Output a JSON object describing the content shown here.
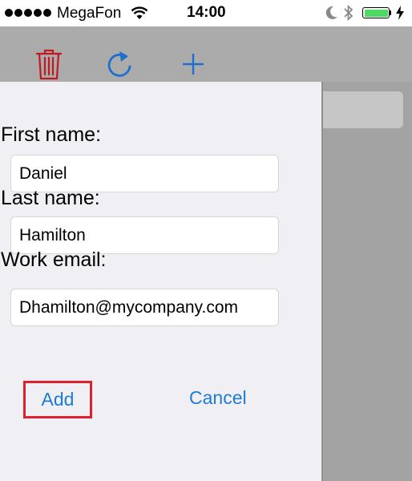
{
  "status_bar": {
    "carrier": "MegaFon",
    "time": "14:00"
  },
  "toolbar": {
    "icons": [
      "trash-icon",
      "refresh-icon",
      "plus-icon"
    ],
    "trash_color": "#c0191f",
    "accent_color": "#1e6fd0"
  },
  "form": {
    "first_name_label": "First name:",
    "first_name_value": "Daniel",
    "last_name_label": "Last name:",
    "last_name_value": "Hamilton",
    "email_label": "Work email:",
    "email_value": "Dhamilton@mycompany.com"
  },
  "actions": {
    "add_label": "Add",
    "cancel_label": "Cancel"
  }
}
